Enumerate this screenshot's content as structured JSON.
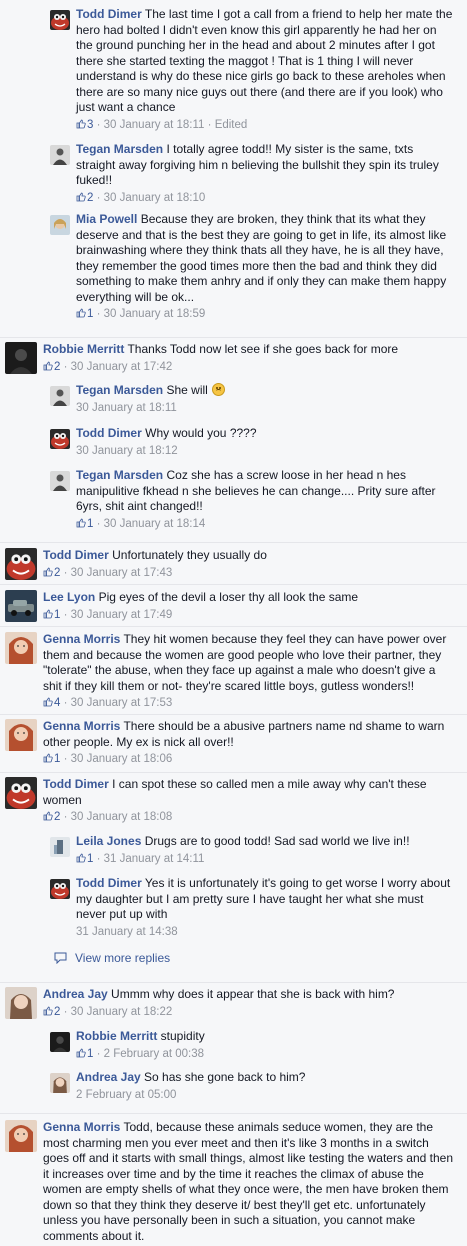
{
  "view_more_replies": "View more replies",
  "comments": [
    {
      "name": "Todd Dimer",
      "text": "The last time I got a call from a friend to help her mate the hero had bolted I didn't even know this girl apparently he had her on the ground punching her in the head and about 2 minutes after I got there she started texting the maggot ! That is 1 thing I will never understand is why do these nice girls go back to these areholes when there are so many nice guys out there (and there are if you look) who just want a chance",
      "likes": "3",
      "time": "30 January at 18:11",
      "edited": "Edited",
      "avatar": "muppet-red"
    },
    {
      "name": "Tegan Marsden",
      "text": "I totally agree todd!! My sister is the same, txts straight away forgiving him n believing the bullshit they spin its truley fuked!!",
      "likes": "",
      "time": "30 January at 18:10",
      "avatar": "grey-person"
    },
    {
      "name": "Mia Powell",
      "text": "Because they are broken, they think that its what they deserve and that is the best they are going to get in life, its almost like brainwashing where they think thats all they have, he is all they have, they remember the good times more then the bad and think they did something to make them anhry and if only they can make them happy everything will be ok...",
      "likes": "1",
      "time": "30 January at 18:59",
      "avatar": "blonde"
    },
    {
      "name": "Robbie Merritt",
      "text": "Thanks Todd now let see if she goes back for more",
      "likes": "2",
      "time": "30 January at 17:42",
      "avatar": "dark"
    },
    {
      "name": "Tegan Marsden",
      "text": "She will",
      "likes": "",
      "time": "30 January at 18:11",
      "avatar": "grey-person"
    },
    {
      "name": "Todd Dimer",
      "text": "Why would you ????",
      "likes": "",
      "time": "30 January at 18:12",
      "avatar": "muppet-red"
    },
    {
      "name": "Tegan Marsden",
      "text": "Coz she has a screw loose in her head n hes manipulitive fkhead n she believes he can change.... Prity sure after 6yrs, shit aint changed!!",
      "likes": "1",
      "time": "30 January at 18:14",
      "avatar": "grey-person"
    },
    {
      "name": "Todd Dimer",
      "text": "Unfortunately they usually do",
      "likes": "2",
      "time": "30 January at 17:43",
      "avatar": "muppet-red"
    },
    {
      "name": "Lee Lyon",
      "text": "Pig eyes of the devil a loser thy all look the same",
      "likes": "1",
      "time": "30 January at 17:49",
      "avatar": "car"
    },
    {
      "name": "Genna Morris",
      "text": "They hit women because they feel they can have power over them and because the women are good people who love their partner, they \"tolerate\" the abuse, when they face up against a male who doesn't give a shit if they kill them or not- they're scared little boys, gutless wonders!!",
      "likes": "4",
      "time": "30 January at 17:53",
      "avatar": "redhead"
    },
    {
      "name": "Genna Morris",
      "text": "There should be a abusive partners name nd shame to warn other people. My ex is nick all over!!",
      "likes": "1",
      "time": "30 January at 18:06",
      "avatar": "redhead"
    },
    {
      "name": "Todd Dimer",
      "text": "I can spot these so called men a mile away why can't these women",
      "likes": "2",
      "time": "30 January at 18:08",
      "avatar": "muppet-red"
    },
    {
      "name": "Leila Jones",
      "text": "Drugs are to good todd! Sad sad world we live in!!",
      "likes": "1",
      "time": "31 January at 14:11",
      "avatar": "blue-grey"
    },
    {
      "name": "Todd Dimer",
      "text": "Yes it is unfortunately it's going to get worse I worry about my daughter but I am pretty sure I have taught her what she must never put up with",
      "likes": "",
      "time": "31 January at 14:38",
      "avatar": "muppet-red"
    },
    {
      "name": "Andrea Jay",
      "text": "Ummm why does it appear that she is back with him?",
      "likes": "2",
      "time": "30 January at 18:22",
      "avatar": "woman-light"
    },
    {
      "name": "Robbie Merritt",
      "text": "stupidity",
      "likes": "1",
      "time": "2 February at 00:38",
      "avatar": "dark"
    },
    {
      "name": "Andrea Jay",
      "text": "So has she gone back to him?",
      "likes": "",
      "time": "2 February at 05:00",
      "avatar": "woman-light"
    },
    {
      "name": "Genna Morris",
      "text": "Todd, because these animals seduce women, they are the most charming men you ever meet and then it's like 3 months in a switch goes off and it starts with small things, almost like testing the waters and then it increases over time and by the time it reaches the climax of abuse the women are empty shells of what they once were, the men have broken them down so that they think they deserve it/ best they'll get etc. unfortunately unless you have personally been in such a situation, you cannot make comments about it.",
      "likes": "",
      "time": "",
      "avatar": "redhead"
    }
  ],
  "extra_likes": {
    "tegan_1": "2"
  },
  "colors": {
    "link": "#3b5998",
    "meta": "#90949c",
    "text": "#141823",
    "bg": "#f6f7f9"
  }
}
